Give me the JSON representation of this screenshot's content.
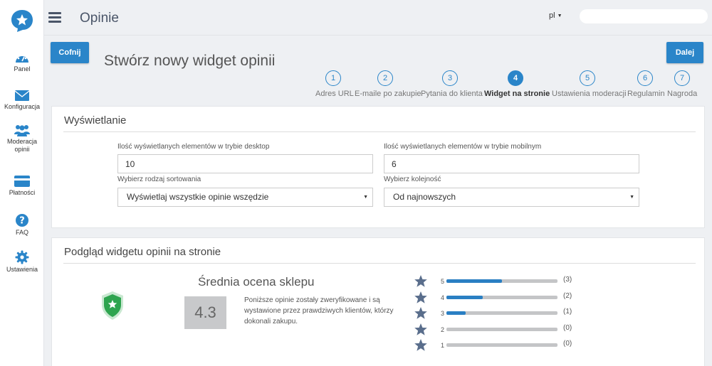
{
  "sidebar": {
    "items": [
      {
        "label": "Panel",
        "icon": "dashboard-gauge-icon"
      },
      {
        "label": "Konfiguracja",
        "icon": "envelope-icon"
      },
      {
        "label1": "Moderacja",
        "label2": "opinii",
        "icon": "users-icon"
      },
      {
        "label": "Płatności",
        "icon": "credit-card-icon"
      },
      {
        "label": "FAQ",
        "icon": "question-circle-icon"
      },
      {
        "label": "Ustawienia",
        "icon": "gear-icon"
      }
    ]
  },
  "header": {
    "title": "Opinie",
    "language": "pl",
    "search_value": ""
  },
  "page": {
    "back_label": "Cofnij",
    "next_label": "Dalej",
    "title": "Stwórz nowy widget opinii"
  },
  "steps": [
    {
      "num": "1",
      "label": "Adres URL"
    },
    {
      "num": "2",
      "label": "E-maile po zakupie"
    },
    {
      "num": "3",
      "label": "Pytania do klienta"
    },
    {
      "num": "4",
      "label": "Widget na stronie",
      "active": true
    },
    {
      "num": "5",
      "label": "Ustawienia moderacji"
    },
    {
      "num": "6",
      "label": "Regulamin"
    },
    {
      "num": "7",
      "label": "Nagroda"
    }
  ],
  "display": {
    "title": "Wyświetlanie",
    "desktop_label": "Ilość wyświetlanych elementów w trybie desktop",
    "desktop_value": "10",
    "mobile_label": "Ilość wyświetlanych elementów w trybie mobilnym",
    "mobile_value": "6",
    "sort_label": "Wybierz rodzaj sortowania",
    "sort_value": "Wyświetlaj wszystkie opinie wszędzie",
    "order_label": "Wybierz kolejność",
    "order_value": "Od najnowszych"
  },
  "preview": {
    "title": "Podgląd widgetu opinii na stronie",
    "avg_title": "Średnia ocena sklepu",
    "avg_value": "4.3",
    "description": "Poniższe opinie zostały zweryfikowane i są wystawione przez prawdziwych klientów, którzy dokonali zakupu.",
    "ratings": [
      {
        "stars": "5",
        "count": "(3)",
        "fraction": 0.5
      },
      {
        "stars": "4",
        "count": "(2)",
        "fraction": 0.33
      },
      {
        "stars": "3",
        "count": "(1)",
        "fraction": 0.17
      },
      {
        "stars": "2",
        "count": "(0)",
        "fraction": 0
      },
      {
        "stars": "1",
        "count": "(0)",
        "fraction": 0
      }
    ]
  },
  "colors": {
    "accent": "#2a85c9",
    "shield": "#2ea44f",
    "star": "#5a6e8c"
  }
}
